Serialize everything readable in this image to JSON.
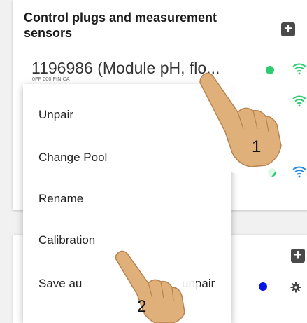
{
  "section": {
    "title": "Control plugs and measurement sensors"
  },
  "device": {
    "name": "1196986 (Module pH, flo...",
    "subtitle": "0FF 000 FIN CA"
  },
  "context_menu": {
    "items": [
      {
        "label": "Unpair"
      },
      {
        "label": "Change Pool"
      },
      {
        "label": "Rename"
      },
      {
        "label": "Calibration"
      },
      {
        "label": "Save au"
      }
    ],
    "partial_right_text": "unpair"
  },
  "annotations": {
    "step_1": "1",
    "step_2": "2"
  },
  "icons": {
    "add": "plus-icon",
    "wifi": "wifi-icon",
    "settings": "gear-icon",
    "hand": "pointing-hand-icon"
  },
  "colors": {
    "status_green": "#2ecc71",
    "status_blue": "#0a14e6",
    "wifi_green": "#2ecc71",
    "wifi_blue": "#1e88e5",
    "hand_skin": "#e0b07a"
  }
}
